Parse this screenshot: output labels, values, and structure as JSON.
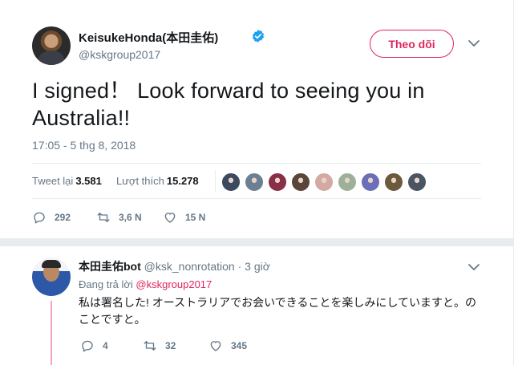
{
  "colors": {
    "accent": "#e0245e",
    "secondary": "#657786",
    "primary_text": "#14171a",
    "verified": "#1da1f2"
  },
  "main_tweet": {
    "author_name": "KeisukeHonda(本田圭佑)",
    "author_handle": "@kskgroup2017",
    "verified_icon": "verified-badge-icon",
    "follow_label": "Theo dõi",
    "text": "I signed！ Look forward to seeing you in Australia!!",
    "timestamp": "17:05 - 5 thg 8, 2018",
    "retweets_label": "Tweet lại",
    "retweets_count": "3.581",
    "likes_label": "Lượt thích",
    "likes_count": "15.278",
    "liker_avatars": [
      {
        "color": "#3b4a5e"
      },
      {
        "color": "#6d7f93"
      },
      {
        "color": "#8a2f4a"
      },
      {
        "color": "#5a4638"
      },
      {
        "color": "#d3a9a4"
      },
      {
        "color": "#9fb09a"
      },
      {
        "color": "#6c6fb8"
      },
      {
        "color": "#6b5a3c"
      },
      {
        "color": "#4a5563"
      }
    ],
    "actions": {
      "replies": "292",
      "retweets": "3,6 N",
      "likes": "15 N"
    }
  },
  "reply_tweet": {
    "author_name": "本田圭佑bot",
    "author_handle": "@ksk_nonrotation",
    "separator": "·",
    "time": "3 giờ",
    "replying_to_label": "Đang trả lời",
    "replying_to_handle": "@kskgroup2017",
    "text": "私は署名した! オーストラリアでお会いできることを楽しみにしていますと。のことですと。",
    "actions": {
      "replies": "4",
      "retweets": "32",
      "likes": "345"
    }
  }
}
